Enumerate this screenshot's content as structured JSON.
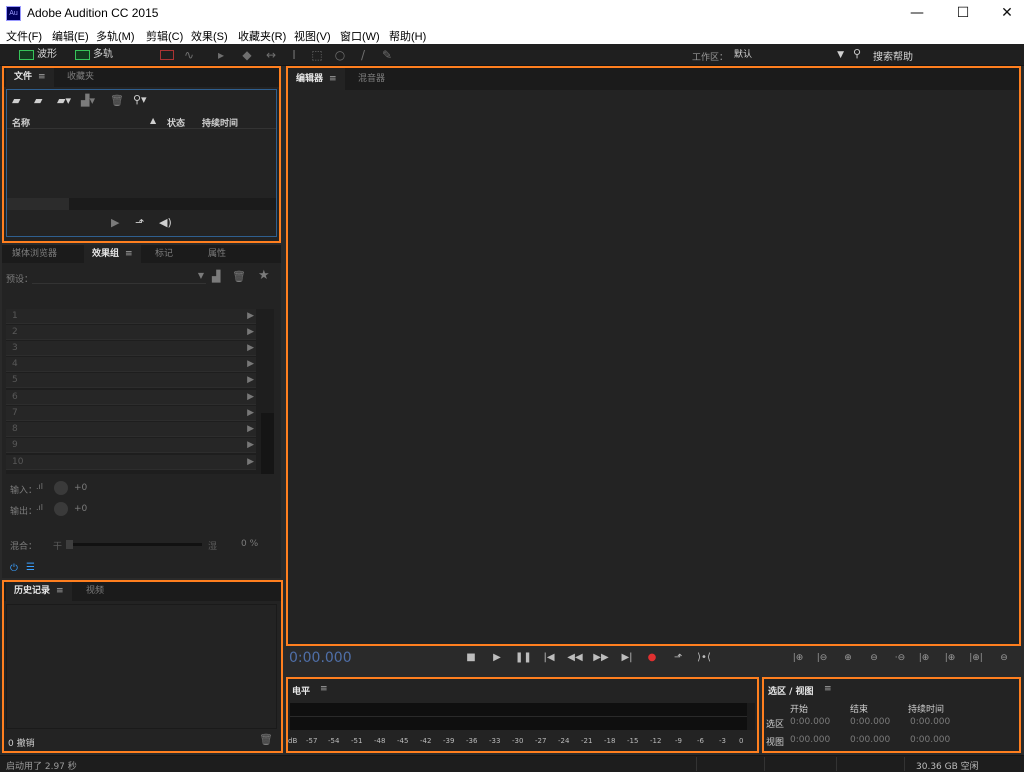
{
  "window": {
    "title": "Adobe Audition CC 2015",
    "logo": "Au"
  },
  "menu": [
    "文件(F)",
    "编辑(E)",
    "多轨(M)",
    "剪辑(C)",
    "效果(S)",
    "收藏夹(R)",
    "视图(V)",
    "窗口(W)",
    "帮助(H)"
  ],
  "toolbar": {
    "waveform": "波形",
    "multitrack": "多轨",
    "workspace_label": "工作区：",
    "workspace_value": "默认",
    "search_help": "搜索帮助"
  },
  "files_panel": {
    "tabs": [
      "文件",
      "收藏夹"
    ],
    "columns": {
      "name": "名称",
      "status": "状态",
      "duration": "持续时间"
    }
  },
  "effects_panel": {
    "tabs": [
      "媒体浏览器",
      "效果组",
      "标记",
      "属性"
    ],
    "preset_label": "预设：",
    "slots": [
      "1",
      "2",
      "3",
      "4",
      "5",
      "6",
      "7",
      "8",
      "9",
      "10"
    ],
    "input_label": "输入：",
    "output_label": "输出：",
    "input_gain": "+0",
    "output_gain": "+0",
    "mix_label": "混合：",
    "dry_label": "干",
    "wet_label": "湿",
    "mix_value": "0 %"
  },
  "history_panel": {
    "tabs": [
      "历史记录",
      "视频"
    ],
    "undo_count": "0 撤销"
  },
  "editor_panel": {
    "tabs": [
      "编辑器",
      "混音器"
    ]
  },
  "transport": {
    "time": "0:00.000"
  },
  "levels_panel": {
    "title": "电平",
    "ticks": [
      "dB",
      "-57",
      "-54",
      "-51",
      "-48",
      "-45",
      "-42",
      "-39",
      "-36",
      "-33",
      "-30",
      "-27",
      "-24",
      "-21",
      "-18",
      "-15",
      "-12",
      "-9",
      "-6",
      "-3",
      "0"
    ]
  },
  "selection_panel": {
    "title": "选区 / 视图",
    "col_start": "开始",
    "col_end": "结束",
    "col_duration": "持续时间",
    "row_selection": "选区",
    "row_view": "视图",
    "sel_start": "0:00.000",
    "sel_end": "0:00.000",
    "sel_duration": "0:00.000",
    "view_start": "0:00.000",
    "view_end": "0:00.000",
    "view_duration": "0:00.000"
  },
  "statusbar": {
    "launch_time": "启动用了 2.97 秒",
    "disk_free": "30.36 GB 空闲"
  },
  "colors": {
    "highlight": "#ff7f1f",
    "record": "#e03030",
    "accent_blue": "#3aa0ff"
  }
}
